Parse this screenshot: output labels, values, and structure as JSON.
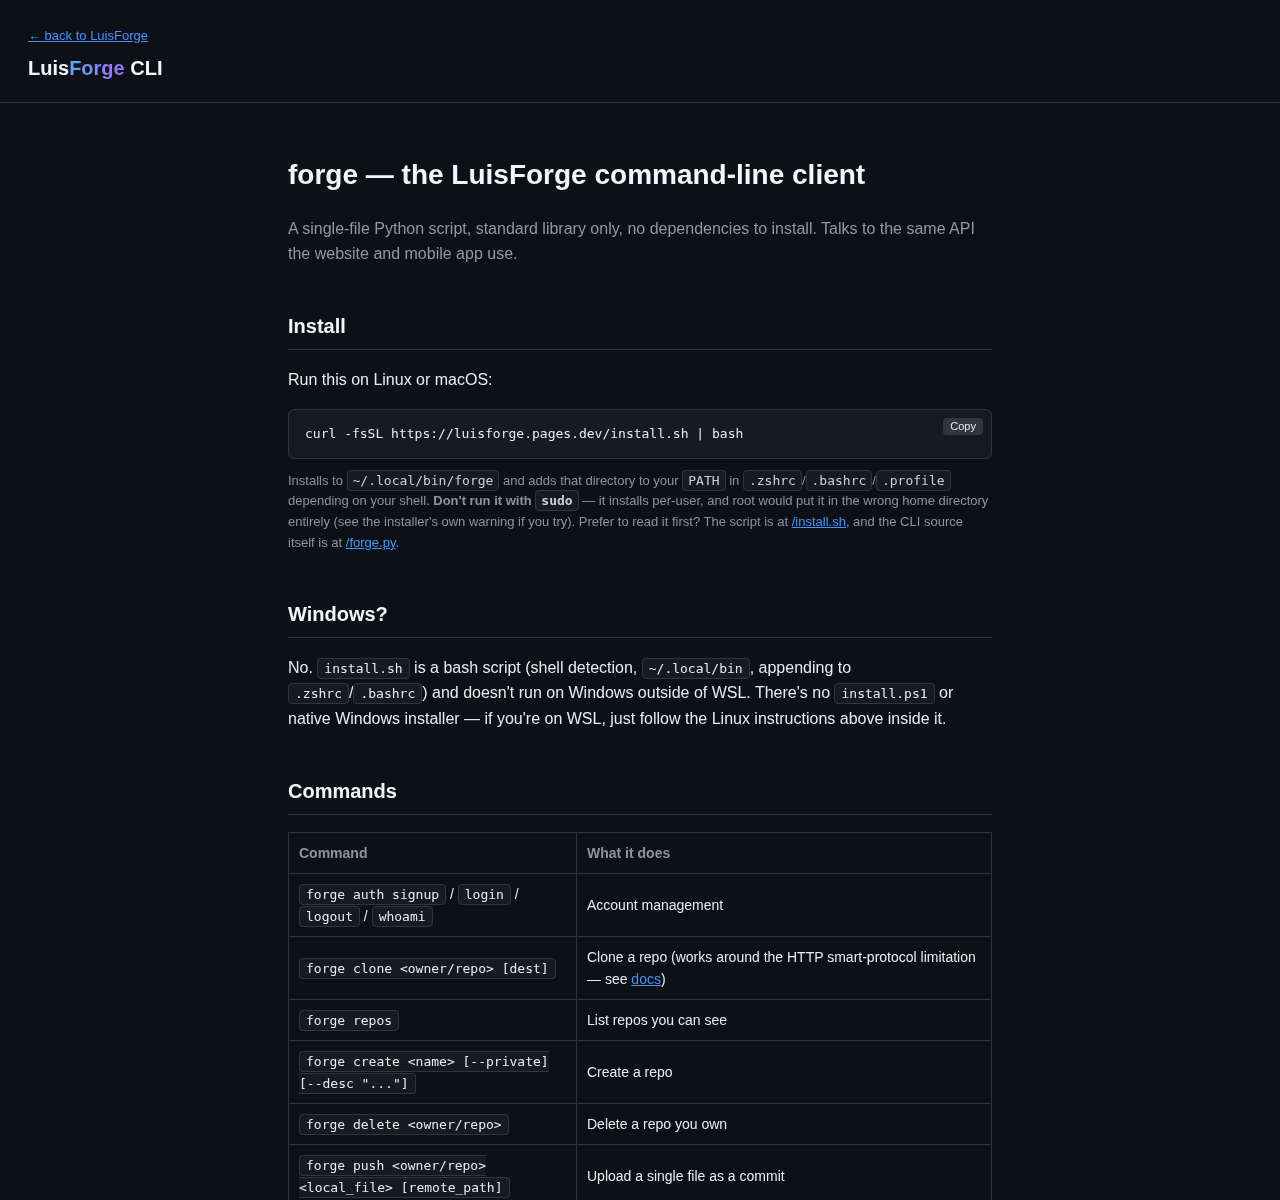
{
  "header": {
    "back_link": "← back to LuisForge",
    "title": [
      {
        "kind": "plain",
        "text": "Luis"
      },
      {
        "kind": "accent",
        "text": "Forge"
      },
      {
        "kind": "plain",
        "text": " CLI"
      }
    ]
  },
  "page": {
    "title": "forge — the LuisForge command-line client",
    "lead": "A single-file Python script, standard library only, no dependencies to install. Talks to the same API the website and mobile app use."
  },
  "sections": [
    {
      "heading": "Install",
      "blocks": [
        {
          "kind": "paragraph",
          "segments": [
            {
              "kind": "text",
              "text": "Run this on Linux or macOS:"
            }
          ]
        },
        {
          "kind": "codeblock",
          "code": "curl -fsSL https://luisforge.pages.dev/install.sh | bash",
          "copy_label": "Copy"
        },
        {
          "kind": "note",
          "segments": [
            {
              "kind": "text",
              "text": "Installs to "
            },
            {
              "kind": "code",
              "text": "~/.local/bin/forge"
            },
            {
              "kind": "text",
              "text": " and adds that directory to your "
            },
            {
              "kind": "code",
              "text": "PATH"
            },
            {
              "kind": "text",
              "text": " in "
            },
            {
              "kind": "code",
              "text": ".zshrc"
            },
            {
              "kind": "text",
              "text": "/"
            },
            {
              "kind": "code",
              "text": ".bashrc"
            },
            {
              "kind": "text",
              "text": "/"
            },
            {
              "kind": "code",
              "text": ".profile"
            },
            {
              "kind": "text",
              "text": " depending on your shell. **Don't run it with** "
            },
            {
              "kind": "boldcode",
              "text": "sudo"
            },
            {
              "kind": "text",
              "text": " — it installs per-user, and root would put it in the wrong home directory entirely (see the installer's own warning if you try). Prefer to read it first? The script is at "
            },
            {
              "kind": "link",
              "text": "/install.sh"
            },
            {
              "kind": "text",
              "text": ", and the CLI source itself is at "
            },
            {
              "kind": "link",
              "text": "/forge.py"
            },
            {
              "kind": "text",
              "text": "."
            }
          ]
        }
      ]
    },
    {
      "heading": "Windows?",
      "blocks": [
        {
          "kind": "paragraph",
          "segments": [
            {
              "kind": "text",
              "text": "No. "
            },
            {
              "kind": "code",
              "text": "install.sh"
            },
            {
              "kind": "text",
              "text": " is a bash script (shell detection, "
            },
            {
              "kind": "code",
              "text": "~/.local/bin"
            },
            {
              "kind": "text",
              "text": ", appending to "
            },
            {
              "kind": "code",
              "text": ".zshrc"
            },
            {
              "kind": "text",
              "text": "/"
            },
            {
              "kind": "code",
              "text": ".bashrc"
            },
            {
              "kind": "text",
              "text": ") and doesn't run on Windows outside of WSL. There's no "
            },
            {
              "kind": "code",
              "text": "install.ps1"
            },
            {
              "kind": "text",
              "text": " or native Windows installer — if you're on WSL, just follow the Linux instructions above inside it."
            }
          ]
        }
      ]
    },
    {
      "heading": "Commands",
      "blocks": [
        {
          "kind": "table",
          "columns": [
            "Command",
            "What it does"
          ],
          "rows": [
            {
              "command": [
                {
                  "kind": "code",
                  "text": "forge auth signup"
                },
                {
                  "kind": "text",
                  "text": " / "
                },
                {
                  "kind": "code",
                  "text": "login"
                },
                {
                  "kind": "text",
                  "text": " / "
                },
                {
                  "kind": "code",
                  "text": "logout"
                },
                {
                  "kind": "text",
                  "text": " / "
                },
                {
                  "kind": "code",
                  "text": "whoami"
                }
              ],
              "description": [
                {
                  "kind": "text",
                  "text": "Account management"
                }
              ]
            },
            {
              "command": [
                {
                  "kind": "code",
                  "text": "forge clone <owner/repo> [dest]"
                }
              ],
              "description": [
                {
                  "kind": "text",
                  "text": "Clone a repo (works around the HTTP smart-protocol limitation — see "
                },
                {
                  "kind": "link",
                  "text": "docs"
                },
                {
                  "kind": "text",
                  "text": ")"
                }
              ]
            },
            {
              "command": [
                {
                  "kind": "code",
                  "text": "forge repos"
                }
              ],
              "description": [
                {
                  "kind": "text",
                  "text": "List repos you can see"
                }
              ]
            },
            {
              "command": [
                {
                  "kind": "code",
                  "text": "forge create <name> [--private] [--desc \"...\"]"
                }
              ],
              "description": [
                {
                  "kind": "text",
                  "text": "Create a repo"
                }
              ]
            },
            {
              "command": [
                {
                  "kind": "code",
                  "text": "forge delete <owner/repo>"
                }
              ],
              "description": [
                {
                  "kind": "text",
                  "text": "Delete a repo you own"
                }
              ]
            },
            {
              "command": [
                {
                  "kind": "code",
                  "text": "forge push <owner/repo> <local_file> [remote_path]"
                }
              ],
              "description": [
                {
                  "kind": "text",
                  "text": "Upload a single file as a commit"
                }
              ]
            }
          ]
        }
      ]
    }
  ]
}
